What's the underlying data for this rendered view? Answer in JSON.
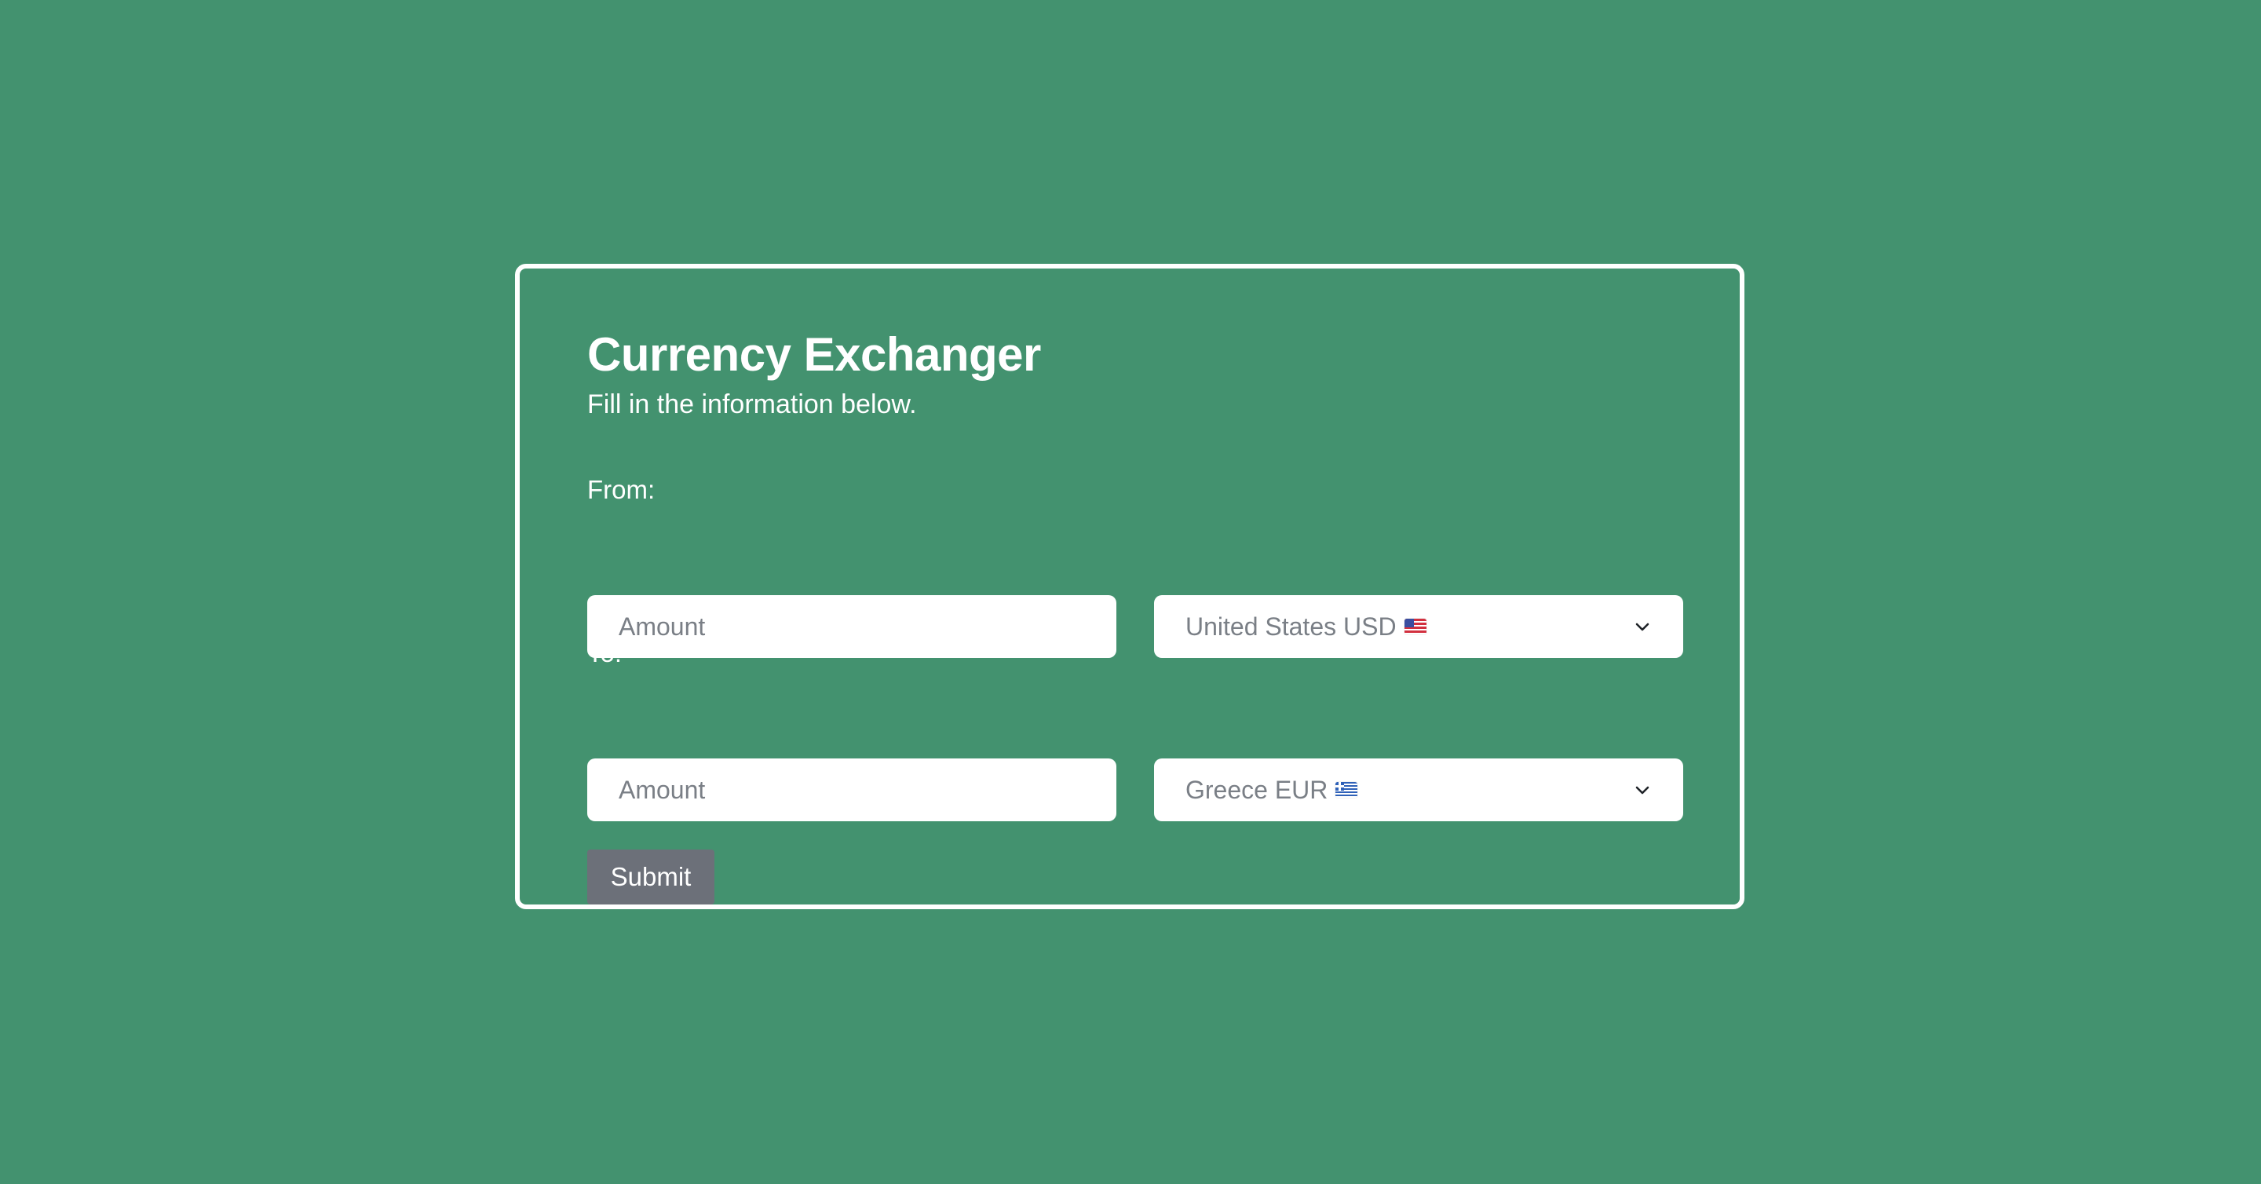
{
  "page": {
    "title": "Currency Exchanger",
    "subtitle": "Fill in the information below."
  },
  "form": {
    "from": {
      "label": "From:",
      "amount_placeholder": "Amount",
      "currency_selected": "United States USD",
      "flag_icon": "us-flag-icon"
    },
    "to": {
      "label": "To:",
      "amount_placeholder": "Amount",
      "currency_selected": "Greece EUR",
      "flag_icon": "greece-flag-icon"
    },
    "submit_label": "Submit"
  },
  "colors": {
    "background": "#43926f",
    "card_border": "#ffffff",
    "field_background": "#ffffff",
    "submit_background": "#6c7079",
    "placeholder_text": "#7a7f86"
  }
}
